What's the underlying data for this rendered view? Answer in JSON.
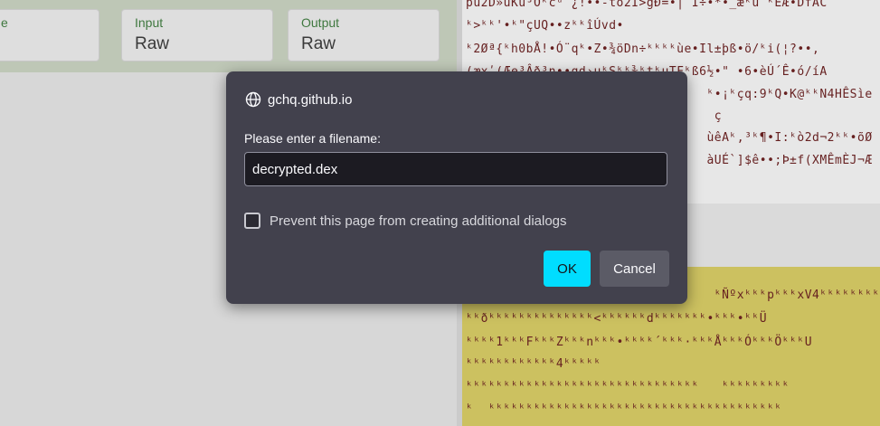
{
  "background": {
    "fields": [
      {
        "label": "e",
        "value": ""
      },
      {
        "label": "Input",
        "value": "Raw"
      },
      {
        "label": "Output",
        "value": "Raw"
      }
    ],
    "output_lines_top": [
      "pu2D»uKu³Oᵏcᵘ¨¿!••-to2Í>gÐ=•| Í÷•*•_æᵏu ᵏEÆ•DfAC",
      "ᵏ>ᵏᵏ'•ᵏ\"çUQ••zᵏᵏîÚvd•",
      "ᵏ2Øª{ᵏh0bÅ!•Ó¨qᵏ•Z•¾öDn÷ᵏᵏᵏᵏùe•Il±þß•ö/ᵏi(¦?••,",
      "(æxʹ(Æe³Âð³n••gd›uᵏSᵏᵏ¾ᵏtᵏuTFᵏß6½•\" •6•èÚ´Ê•ó/íA",
      "                                ᵏ•¡ᵏçq:9ᵏQ•K@ᵏᵏN4HÊSìe",
      "                                 ç",
      "                                ùêAᵏ,³ᵏ¶•I:ᵏò2d¬2ᵏᵏ•õØ",
      "                                àUÉ`]$ê••;Þ±f(XMÊmÈJ¬Æ"
    ],
    "output_lines_yellow": [
      "                                 ᵏÑºxᵏᵏᵏpᵏᵏᵏxV4ᵏᵏᵏᵏᵏᵏᵏᵏ",
      "ᵏᵏðᵏᵏᵏᵏᵏᵏᵏᵏᵏᵏᵏᵏᵏᵏ<ᵏᵏᵏᵏᵏᵏdᵏᵏᵏᵏᵏᵏᵏ•ᵏᵏᵏ•ᵏᵏÜ",
      "ᵏᵏᵏᵏ1ᵏᵏᵏFᵏᵏᵏZᵏᵏᵏnᵏᵏᵏ•ᵏᵏᵏᵏ´ᵏᵏᵏ·ᵏᵏᵏÅᵏᵏᵏÓᵏᵏᵏÖᵏᵏᵏU",
      "ᵏᵏᵏᵏᵏᵏᵏᵏᵏᵏᵏᵏ4ᵏᵏᵏᵏᵏ",
      "ᵏᵏᵏᵏᵏᵏᵏᵏᵏᵏᵏᵏᵏᵏᵏᵏᵏᵏᵏᵏᵏᵏᵏᵏᵏᵏᵏᵏᵏᵏᵏ   ᵏᵏᵏᵏᵏᵏᵏᵏᵏ",
      "ᵏ  ᵏᵏᵏᵏᵏᵏᵏᵏᵏᵏᵏᵏᵏᵏᵏᵏᵏᵏᵏᵏᵏᵏᵏᵏᵏᵏᵏᵏᵏᵏᵏᵏᵏᵏᵏᵏᵏᵏᵏ"
    ]
  },
  "dialog": {
    "origin": "gchq.github.io",
    "prompt": "Please enter a filename:",
    "filename_value": "decrypted.dex",
    "checkbox_label": "Prevent this page from creating additional dialogs",
    "checkbox_checked": false,
    "ok_label": "OK",
    "cancel_label": "Cancel",
    "icon": "globe-icon",
    "colors": {
      "accent": "#00ddff",
      "dialog_bg": "#42414d"
    }
  }
}
